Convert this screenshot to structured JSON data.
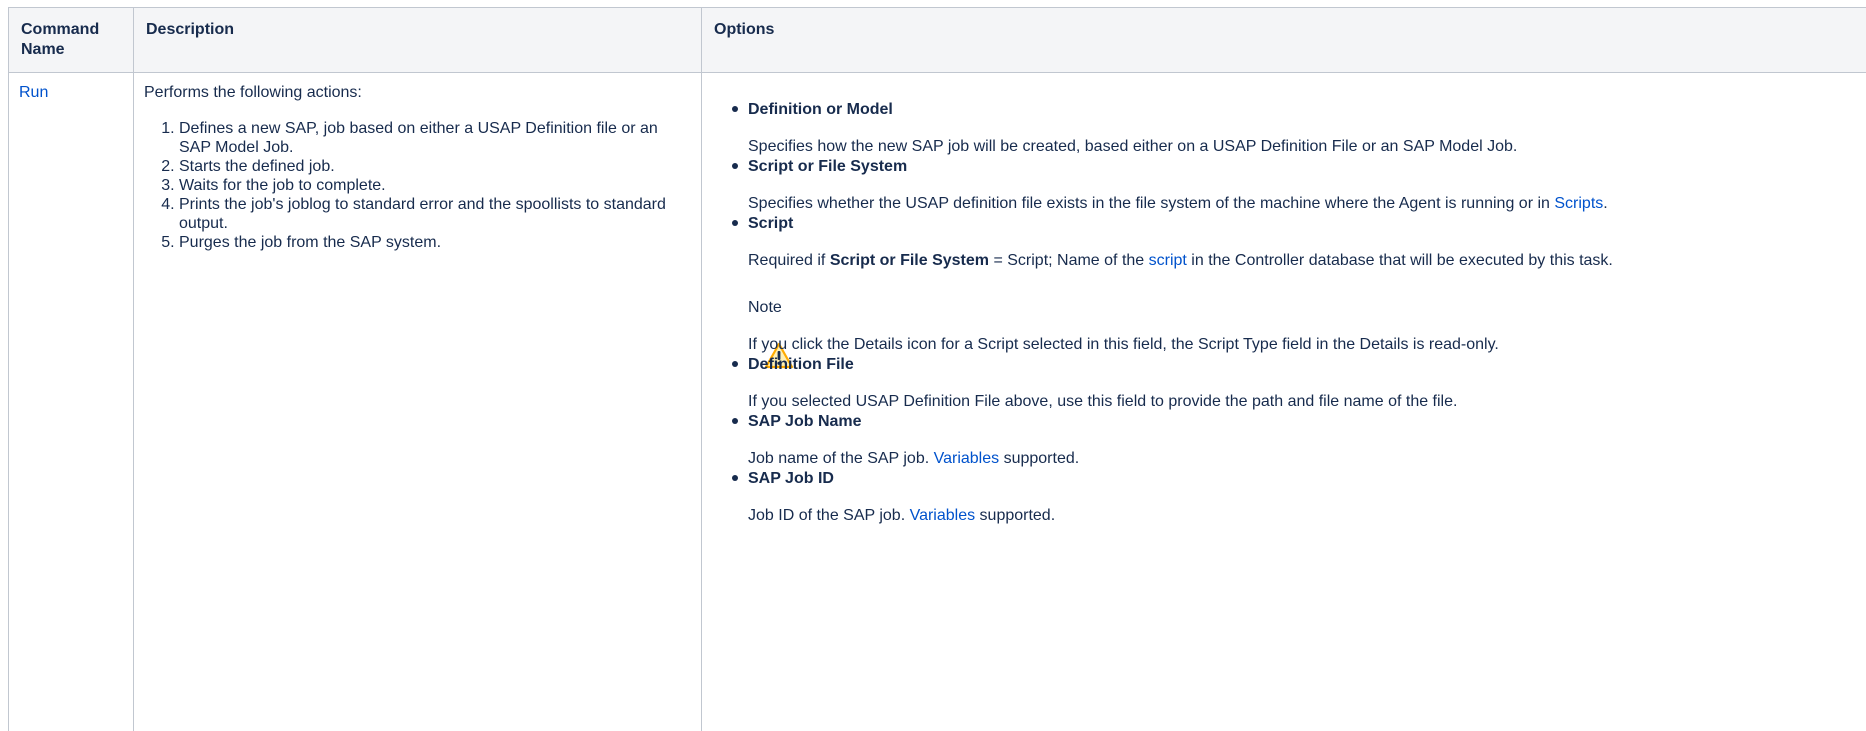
{
  "table": {
    "headers": [
      "Command Name",
      "Description",
      "Options"
    ],
    "command": "Run",
    "description": {
      "intro": "Performs the following actions:",
      "steps": [
        "Defines a new SAP, job based on either a USAP Definition file or an SAP Model Job.",
        "Starts the defined job.",
        "Waits for the job to complete.",
        "Prints the job's joblog to standard error and the spoollists to standard output.",
        "Purges the job from the SAP system."
      ]
    },
    "options": {
      "def_model": {
        "title": "Definition or Model",
        "desc": "Specifies how the new SAP job will be created, based either on a USAP Definition File or an SAP Model Job."
      },
      "script_fs": {
        "title": "Script or File System",
        "desc_pre": "Specifies whether the USAP definition file exists in the file system of the machine where the Agent is running or in ",
        "desc_link": "Scripts",
        "desc_post": "."
      },
      "script": {
        "title": "Script",
        "desc_pre": "Required if ",
        "desc_bold": "Script or File System",
        "desc_mid": " = Script; Name of the ",
        "desc_link": "script",
        "desc_post": " in the Controller database that will be executed by this task.",
        "note_title": "Note",
        "note_text": "If you click the Details icon for a Script selected in this field, the Script Type field in the Details is read-only.",
        "note_icon": "warning-icon"
      },
      "def_file": {
        "title": "Definition File",
        "desc": "If you selected USAP Definition File above, use this field to provide the path and file name of the file."
      },
      "job_name": {
        "title": "SAP Job Name",
        "desc_pre": "Job name of the SAP job. ",
        "desc_link": "Variables",
        "desc_post": " supported."
      },
      "job_id": {
        "title": "SAP Job ID",
        "desc_pre": "Job ID of the SAP job. ",
        "desc_link": "Variables",
        "desc_post": " supported."
      }
    }
  },
  "colors": {
    "link": "#0052cc",
    "header_bg": "#f4f5f7",
    "border": "#c1c7d0",
    "warning": "#ffab00"
  }
}
